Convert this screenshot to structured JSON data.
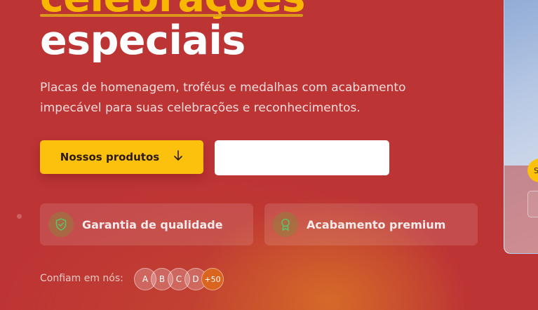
{
  "hero": {
    "title_line1": "celebrações",
    "title_line2": "especiais",
    "description": "Placas de homenagem, troféus e medalhas com acabamento impecável para suas celebrações e reconhecimentos."
  },
  "buttons": {
    "primary_label": "Nossos produtos",
    "primary_icon": "arrow-down-icon",
    "secondary_label": ""
  },
  "features": [
    {
      "label": "Garantia de qualidade",
      "icon": "shield-check-icon"
    },
    {
      "label": "Acabamento premium",
      "icon": "award-ribbon-icon"
    }
  ],
  "trust": {
    "label": "Confiam em nós:",
    "avatars": [
      "A",
      "B",
      "C",
      "D"
    ],
    "more": "+50"
  },
  "side_card": {
    "badge_text": "S"
  },
  "colors": {
    "background": "#bd3435",
    "accent_yellow": "#fbc10c",
    "title_yellow": "#f8b800"
  }
}
